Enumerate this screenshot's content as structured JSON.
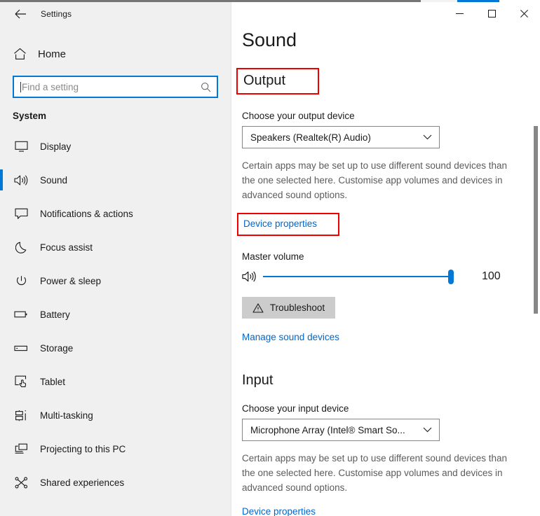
{
  "window": {
    "app_title": "Settings",
    "back_icon": "back-arrow-icon",
    "minimize_label": "—",
    "maximize_label": "□",
    "close_label": "✕",
    "accent_color": "#0078d7",
    "highlight_color": "#ee0000"
  },
  "sidebar": {
    "home_label": "Home",
    "home_icon": "home-icon",
    "search": {
      "placeholder": "Find a setting",
      "value": "",
      "icon": "search-icon"
    },
    "group_label": "System",
    "items": [
      {
        "label": "Display",
        "icon": "monitor-icon",
        "selected": false
      },
      {
        "label": "Sound",
        "icon": "speaker-icon",
        "selected": true
      },
      {
        "label": "Notifications & actions",
        "icon": "chat-bubble-icon",
        "selected": false
      },
      {
        "label": "Focus assist",
        "icon": "moon-icon",
        "selected": false
      },
      {
        "label": "Power & sleep",
        "icon": "power-icon",
        "selected": false
      },
      {
        "label": "Battery",
        "icon": "battery-icon",
        "selected": false
      },
      {
        "label": "Storage",
        "icon": "drive-icon",
        "selected": false
      },
      {
        "label": "Tablet",
        "icon": "tablet-icon",
        "selected": false
      },
      {
        "label": "Multi-tasking",
        "icon": "multitasking-icon",
        "selected": false
      },
      {
        "label": "Projecting to this PC",
        "icon": "projecting-icon",
        "selected": false
      },
      {
        "label": "Shared experiences",
        "icon": "share-icon",
        "selected": false
      }
    ]
  },
  "main": {
    "page_title": "Sound",
    "output": {
      "heading": "Output",
      "device_label": "Choose your output device",
      "device_value": "Speakers (Realtek(R) Audio)",
      "description": "Certain apps may be set up to use different sound devices than the one selected here. Customise app volumes and devices in advanced sound options.",
      "device_properties_label": "Device properties",
      "volume_label": "Master volume",
      "volume_value": "100",
      "volume_percent": 100,
      "volume_icon": "speaker-volume-icon",
      "troubleshoot_label": "Troubleshoot",
      "troubleshoot_icon": "warning-triangle-icon",
      "manage_devices_label": "Manage sound devices"
    },
    "input": {
      "heading": "Input",
      "device_label": "Choose your input device",
      "device_value": "Microphone Array (Intel® Smart So...",
      "description": "Certain apps may be set up to use different sound devices than the one selected here. Customise app volumes and devices in advanced sound options.",
      "device_properties_label": "Device properties"
    }
  }
}
